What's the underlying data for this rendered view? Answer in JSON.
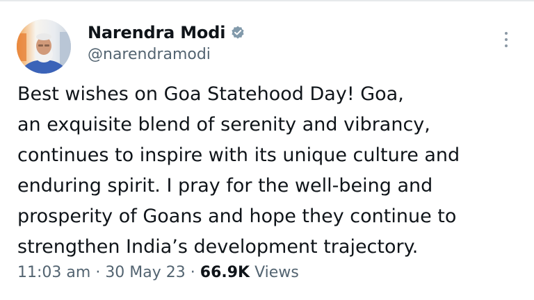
{
  "author": {
    "display_name": "Narendra Modi",
    "handle": "@narendramodi",
    "verified": true,
    "avatar_icon": "profile-photo"
  },
  "tweet": {
    "lines": [
      "Best wishes on Goa Statehood Day! Goa,",
      "an exquisite blend of serenity and vibrancy,",
      "continues to inspire with its unique culture and",
      "enduring spirit. I pray for the well-being and",
      "prosperity of Goans and hope they continue to",
      "strengthen India’s development trajectory."
    ]
  },
  "meta": {
    "time": "11:03 am",
    "separator": "·",
    "date": "30 May 23",
    "views_count": "66.9K",
    "views_label": "Views"
  },
  "icons": {
    "verified": "verified-badge-icon",
    "more": "more-vertical-icon"
  },
  "colors": {
    "text_primary": "#0f1419",
    "text_secondary": "#536471",
    "badge": "#829aab"
  }
}
